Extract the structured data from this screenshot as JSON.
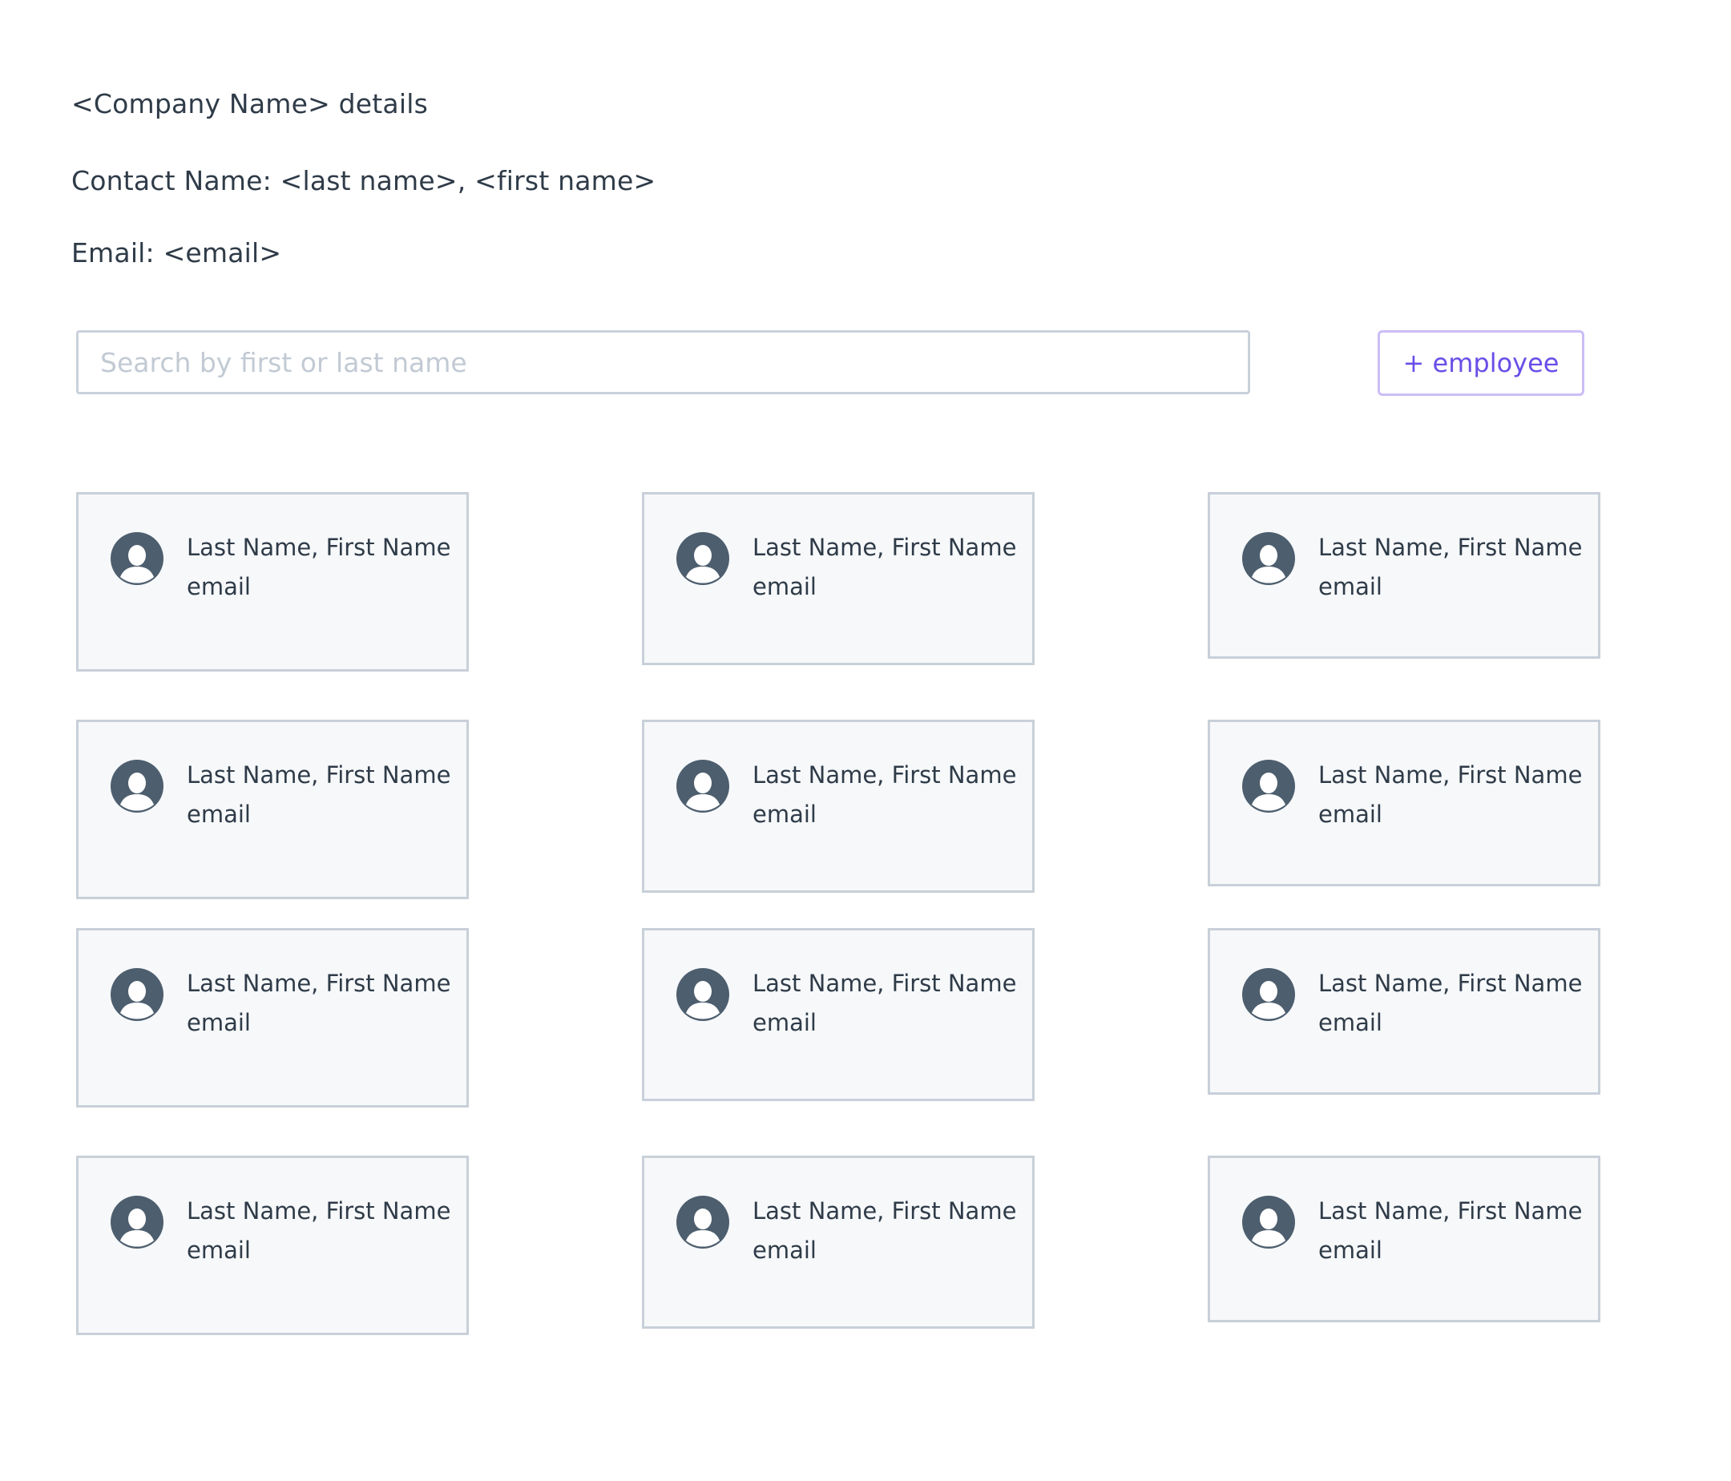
{
  "details": {
    "title": "<Company Name> details",
    "contact": "Contact Name: <last name>, <first name>",
    "email": "Email: <email>"
  },
  "search": {
    "placeholder": "Search by first or last name",
    "value": ""
  },
  "toolbar": {
    "add_employee_label": "+ employee"
  },
  "employees": [
    {
      "name": "Last Name, First Name",
      "email": "email",
      "icon": "user-avatar-icon"
    },
    {
      "name": "Last Name, First Name",
      "email": "email",
      "icon": "user-avatar-icon"
    },
    {
      "name": "Last Name, First Name",
      "email": "email",
      "icon": "user-avatar-icon"
    },
    {
      "name": "Last Name, First Name",
      "email": "email",
      "icon": "user-avatar-icon"
    },
    {
      "name": "Last Name, First Name",
      "email": "email",
      "icon": "user-avatar-icon"
    },
    {
      "name": "Last Name, First Name",
      "email": "email",
      "icon": "user-avatar-icon"
    },
    {
      "name": "Last Name, First Name",
      "email": "email",
      "icon": "user-avatar-icon"
    },
    {
      "name": "Last Name, First Name",
      "email": "email",
      "icon": "user-avatar-icon"
    },
    {
      "name": "Last Name, First Name",
      "email": "email",
      "icon": "user-avatar-icon"
    },
    {
      "name": "Last Name, First Name",
      "email": "email",
      "icon": "user-avatar-icon"
    },
    {
      "name": "Last Name, First Name",
      "email": "email",
      "icon": "user-avatar-icon"
    },
    {
      "name": "Last Name, First Name",
      "email": "email",
      "icon": "user-avatar-icon"
    }
  ],
  "colors": {
    "text": "#2f3b48",
    "placeholder": "#c2cad4",
    "accent": "#6a4ee8",
    "accent_border": "#cbbdf7",
    "card_bg": "#f6f8fa",
    "card_border": "#c8d0d9",
    "avatar": "#4d5e6e"
  }
}
